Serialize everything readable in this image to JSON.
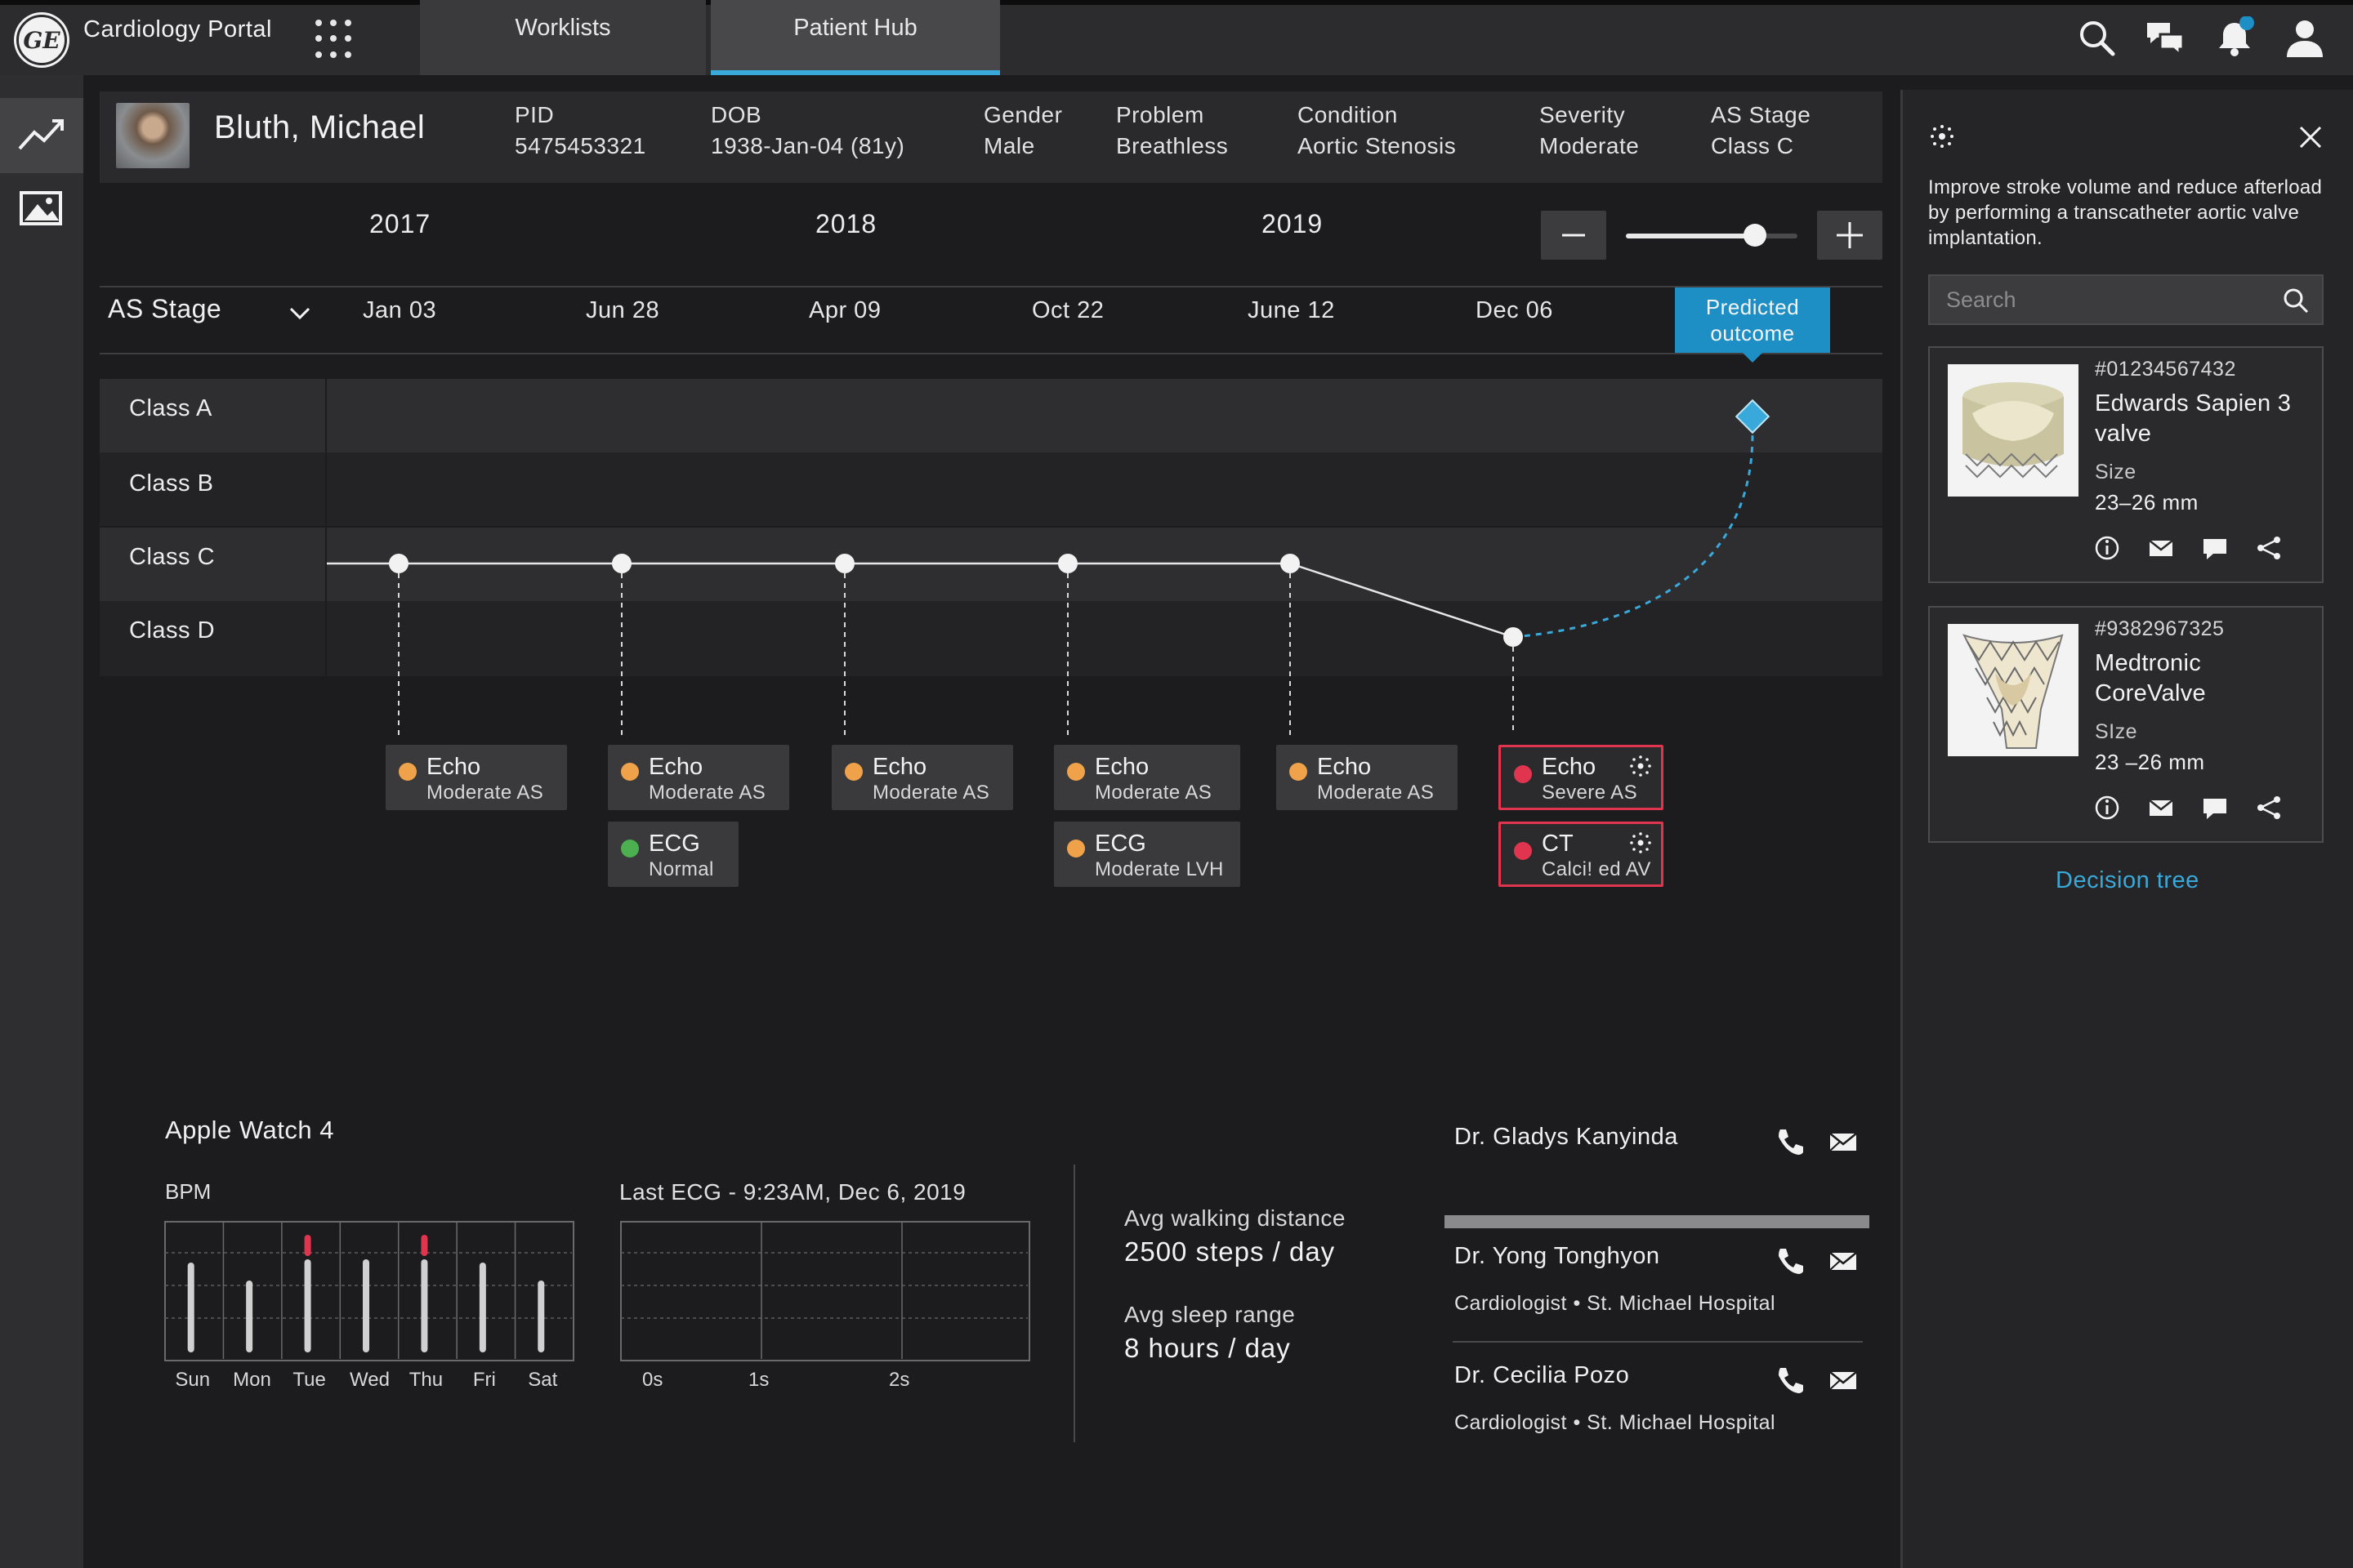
{
  "app": {
    "title": "Cardiology Portal",
    "logo_text": "GE",
    "tabs": [
      {
        "label": "Worklists",
        "active": false
      },
      {
        "label": "Patient Hub",
        "active": true
      }
    ]
  },
  "colors": {
    "accent": "#39a9db",
    "orange": "#f0a24a",
    "green": "#4caf50",
    "red": "#e0344f",
    "predicted": "#1e8fc5"
  },
  "patient": {
    "name": "Bluth, Michael",
    "fields": [
      {
        "label": "PID",
        "value": "5475453321"
      },
      {
        "label": "DOB",
        "value": "1938-Jan-04 (81y)"
      },
      {
        "label": "Gender",
        "value": "Male"
      },
      {
        "label": "Problem",
        "value": "Breathless"
      },
      {
        "label": "Condition",
        "value": "Aortic Stenosis"
      },
      {
        "label": "Severity",
        "value": "Moderate"
      },
      {
        "label": "AS Stage",
        "value": "Class C"
      }
    ]
  },
  "timeline": {
    "years": [
      "2017",
      "2018",
      "2019"
    ],
    "stage_selector": "AS Stage",
    "dates": [
      "Jan 03",
      "Jun 28",
      "Apr 09",
      "Oct 22",
      "June 12",
      "Dec 06"
    ],
    "predicted_label": "Predicted outcome",
    "classes": [
      "Class A",
      "Class B",
      "Class C",
      "Class D"
    ],
    "stage_points": [
      "Class C",
      "Class C",
      "Class C",
      "Class C",
      "Class C",
      "Class D"
    ],
    "predicted_point": "Class A",
    "findings": [
      [
        {
          "type": "Echo",
          "result": "Moderate AS",
          "status": "orange"
        }
      ],
      [
        {
          "type": "Echo",
          "result": "Moderate AS",
          "status": "orange"
        },
        {
          "type": "ECG",
          "result": "Normal",
          "status": "green"
        }
      ],
      [
        {
          "type": "Echo",
          "result": "Moderate AS",
          "status": "orange"
        }
      ],
      [
        {
          "type": "Echo",
          "result": "Moderate AS",
          "status": "orange"
        },
        {
          "type": "ECG",
          "result": "Moderate LVH",
          "status": "orange"
        }
      ],
      [
        {
          "type": "Echo",
          "result": "Moderate AS",
          "status": "orange"
        }
      ],
      [
        {
          "type": "Echo",
          "result": "Severe AS",
          "status": "red"
        },
        {
          "type": "CT",
          "result": "Calci! ed AV",
          "status": "red"
        }
      ]
    ]
  },
  "wearable": {
    "title": "Apple Watch 4",
    "bpm_label": "BPM",
    "days": [
      "Sun",
      "Mon",
      "Tue",
      "Wed",
      "Thu",
      "Fri",
      "Sat"
    ],
    "bpm_alert_days": [
      "Tue",
      "Thu"
    ],
    "ecg_label": "Last ECG - 9:23AM, Dec 6, 2019",
    "ecg_ticks": [
      "0s",
      "1s",
      "2s"
    ]
  },
  "stats": [
    {
      "label": "Avg walking distance",
      "value": "2500 steps / day"
    },
    {
      "label": "Avg sleep range",
      "value": "8 hours / day"
    }
  ],
  "doctors": [
    {
      "name": "Dr. Gladys Kanyinda",
      "role": ""
    },
    {
      "name": "Dr. Yong Tonghyon",
      "role": "Cardiologist • St. Michael Hospital"
    },
    {
      "name": "Dr. Cecilia Pozo",
      "role": "Cardiologist • St. Michael Hospital"
    }
  ],
  "panel": {
    "recommendation": "Improve stroke volume and reduce afterload by performing a transcatheter aortic valve implantation.",
    "search_placeholder": "Search",
    "devices": [
      {
        "id": "#01234567432",
        "name": "Edwards Sapien 3 valve",
        "size_label": "Size",
        "size": "23–26 mm"
      },
      {
        "id": "#9382967325",
        "name": "Medtronic CoreValve",
        "size_label": "SIze",
        "size": "23 –26 mm"
      }
    ],
    "decision_tree": "Decision tree"
  }
}
